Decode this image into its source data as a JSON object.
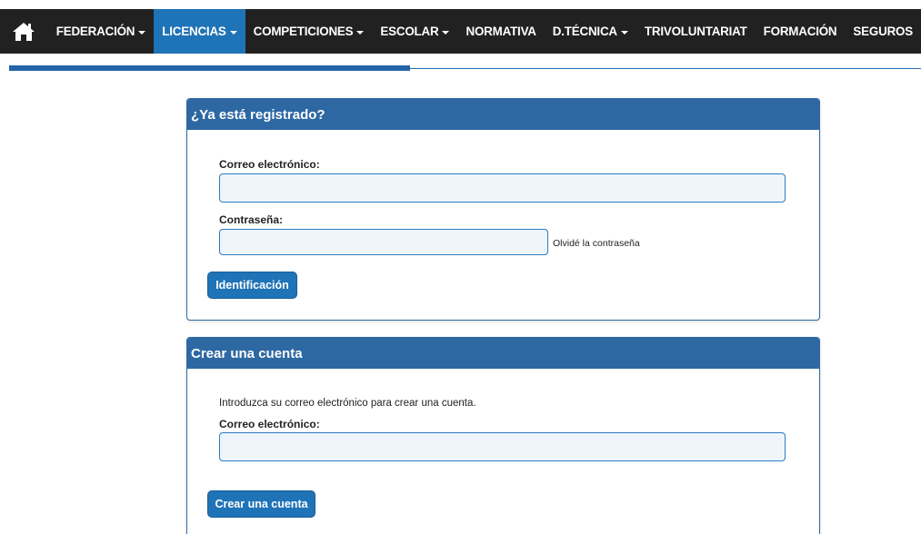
{
  "nav": {
    "items": [
      {
        "label": "FEDERACIÓN",
        "dropdown": true,
        "active": false
      },
      {
        "label": "LICENCIAS",
        "dropdown": true,
        "active": true
      },
      {
        "label": "COMPETICIONES",
        "dropdown": true,
        "active": false
      },
      {
        "label": "ESCOLAR",
        "dropdown": true,
        "active": false
      },
      {
        "label": "NORMATIVA",
        "dropdown": false,
        "active": false
      },
      {
        "label": "D.TÉCNICA",
        "dropdown": true,
        "active": false
      },
      {
        "label": "TRIVOLUNTARIAT",
        "dropdown": false,
        "active": false
      },
      {
        "label": "FORMACIÓN",
        "dropdown": false,
        "active": false
      },
      {
        "label": "SEGUROS",
        "dropdown": false,
        "active": false
      }
    ],
    "home_icon": "home-icon"
  },
  "progress": {
    "value": 0.44
  },
  "login": {
    "title": "¿Ya está registrado?",
    "email_label": "Correo electrónico:",
    "email_value": "",
    "password_label": "Contraseña:",
    "password_value": "",
    "forgot_link": "Olvidé la contraseña",
    "submit_label": "Identificación"
  },
  "signup": {
    "title": "Crear una cuenta",
    "intro": "Introduzca su correo electrónico para crear una cuenta.",
    "email_label": "Correo electrónico:",
    "email_value": "",
    "submit_label": "Crear una cuenta"
  },
  "colors": {
    "nav_bg": "#212121",
    "accent": "#1f73b7",
    "panel_header": "#2d68a3"
  }
}
